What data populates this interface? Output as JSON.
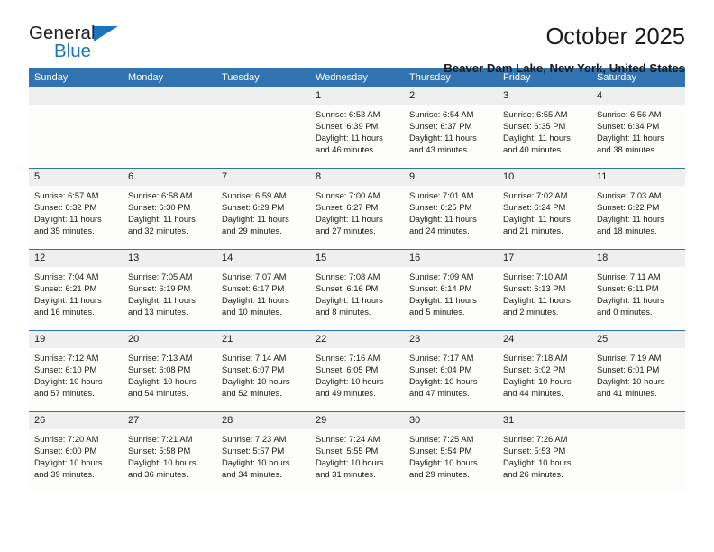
{
  "brand": {
    "name_part1": "General",
    "name_part2": "Blue",
    "triangle_color": "#1b75bb"
  },
  "header": {
    "month_title": "October 2025",
    "location": "Beaver Dam Lake, New York, United States"
  },
  "theme": {
    "header_blue": "#3173b0",
    "daynum_band": "#efefef",
    "cell_background": "#fdfdfc",
    "text": "#1a1a1a"
  },
  "weekday_headers": [
    "Sunday",
    "Monday",
    "Tuesday",
    "Wednesday",
    "Thursday",
    "Friday",
    "Saturday"
  ],
  "weeks": [
    [
      {
        "day": "",
        "sunrise": "",
        "sunset": "",
        "daylight_line1": "",
        "daylight_line2": ""
      },
      {
        "day": "",
        "sunrise": "",
        "sunset": "",
        "daylight_line1": "",
        "daylight_line2": ""
      },
      {
        "day": "",
        "sunrise": "",
        "sunset": "",
        "daylight_line1": "",
        "daylight_line2": ""
      },
      {
        "day": "1",
        "sunrise": "Sunrise: 6:53 AM",
        "sunset": "Sunset: 6:39 PM",
        "daylight_line1": "Daylight: 11 hours",
        "daylight_line2": "and 46 minutes."
      },
      {
        "day": "2",
        "sunrise": "Sunrise: 6:54 AM",
        "sunset": "Sunset: 6:37 PM",
        "daylight_line1": "Daylight: 11 hours",
        "daylight_line2": "and 43 minutes."
      },
      {
        "day": "3",
        "sunrise": "Sunrise: 6:55 AM",
        "sunset": "Sunset: 6:35 PM",
        "daylight_line1": "Daylight: 11 hours",
        "daylight_line2": "and 40 minutes."
      },
      {
        "day": "4",
        "sunrise": "Sunrise: 6:56 AM",
        "sunset": "Sunset: 6:34 PM",
        "daylight_line1": "Daylight: 11 hours",
        "daylight_line2": "and 38 minutes."
      }
    ],
    [
      {
        "day": "5",
        "sunrise": "Sunrise: 6:57 AM",
        "sunset": "Sunset: 6:32 PM",
        "daylight_line1": "Daylight: 11 hours",
        "daylight_line2": "and 35 minutes."
      },
      {
        "day": "6",
        "sunrise": "Sunrise: 6:58 AM",
        "sunset": "Sunset: 6:30 PM",
        "daylight_line1": "Daylight: 11 hours",
        "daylight_line2": "and 32 minutes."
      },
      {
        "day": "7",
        "sunrise": "Sunrise: 6:59 AM",
        "sunset": "Sunset: 6:29 PM",
        "daylight_line1": "Daylight: 11 hours",
        "daylight_line2": "and 29 minutes."
      },
      {
        "day": "8",
        "sunrise": "Sunrise: 7:00 AM",
        "sunset": "Sunset: 6:27 PM",
        "daylight_line1": "Daylight: 11 hours",
        "daylight_line2": "and 27 minutes."
      },
      {
        "day": "9",
        "sunrise": "Sunrise: 7:01 AM",
        "sunset": "Sunset: 6:25 PM",
        "daylight_line1": "Daylight: 11 hours",
        "daylight_line2": "and 24 minutes."
      },
      {
        "day": "10",
        "sunrise": "Sunrise: 7:02 AM",
        "sunset": "Sunset: 6:24 PM",
        "daylight_line1": "Daylight: 11 hours",
        "daylight_line2": "and 21 minutes."
      },
      {
        "day": "11",
        "sunrise": "Sunrise: 7:03 AM",
        "sunset": "Sunset: 6:22 PM",
        "daylight_line1": "Daylight: 11 hours",
        "daylight_line2": "and 18 minutes."
      }
    ],
    [
      {
        "day": "12",
        "sunrise": "Sunrise: 7:04 AM",
        "sunset": "Sunset: 6:21 PM",
        "daylight_line1": "Daylight: 11 hours",
        "daylight_line2": "and 16 minutes."
      },
      {
        "day": "13",
        "sunrise": "Sunrise: 7:05 AM",
        "sunset": "Sunset: 6:19 PM",
        "daylight_line1": "Daylight: 11 hours",
        "daylight_line2": "and 13 minutes."
      },
      {
        "day": "14",
        "sunrise": "Sunrise: 7:07 AM",
        "sunset": "Sunset: 6:17 PM",
        "daylight_line1": "Daylight: 11 hours",
        "daylight_line2": "and 10 minutes."
      },
      {
        "day": "15",
        "sunrise": "Sunrise: 7:08 AM",
        "sunset": "Sunset: 6:16 PM",
        "daylight_line1": "Daylight: 11 hours",
        "daylight_line2": "and 8 minutes."
      },
      {
        "day": "16",
        "sunrise": "Sunrise: 7:09 AM",
        "sunset": "Sunset: 6:14 PM",
        "daylight_line1": "Daylight: 11 hours",
        "daylight_line2": "and 5 minutes."
      },
      {
        "day": "17",
        "sunrise": "Sunrise: 7:10 AM",
        "sunset": "Sunset: 6:13 PM",
        "daylight_line1": "Daylight: 11 hours",
        "daylight_line2": "and 2 minutes."
      },
      {
        "day": "18",
        "sunrise": "Sunrise: 7:11 AM",
        "sunset": "Sunset: 6:11 PM",
        "daylight_line1": "Daylight: 11 hours",
        "daylight_line2": "and 0 minutes."
      }
    ],
    [
      {
        "day": "19",
        "sunrise": "Sunrise: 7:12 AM",
        "sunset": "Sunset: 6:10 PM",
        "daylight_line1": "Daylight: 10 hours",
        "daylight_line2": "and 57 minutes."
      },
      {
        "day": "20",
        "sunrise": "Sunrise: 7:13 AM",
        "sunset": "Sunset: 6:08 PM",
        "daylight_line1": "Daylight: 10 hours",
        "daylight_line2": "and 54 minutes."
      },
      {
        "day": "21",
        "sunrise": "Sunrise: 7:14 AM",
        "sunset": "Sunset: 6:07 PM",
        "daylight_line1": "Daylight: 10 hours",
        "daylight_line2": "and 52 minutes."
      },
      {
        "day": "22",
        "sunrise": "Sunrise: 7:16 AM",
        "sunset": "Sunset: 6:05 PM",
        "daylight_line1": "Daylight: 10 hours",
        "daylight_line2": "and 49 minutes."
      },
      {
        "day": "23",
        "sunrise": "Sunrise: 7:17 AM",
        "sunset": "Sunset: 6:04 PM",
        "daylight_line1": "Daylight: 10 hours",
        "daylight_line2": "and 47 minutes."
      },
      {
        "day": "24",
        "sunrise": "Sunrise: 7:18 AM",
        "sunset": "Sunset: 6:02 PM",
        "daylight_line1": "Daylight: 10 hours",
        "daylight_line2": "and 44 minutes."
      },
      {
        "day": "25",
        "sunrise": "Sunrise: 7:19 AM",
        "sunset": "Sunset: 6:01 PM",
        "daylight_line1": "Daylight: 10 hours",
        "daylight_line2": "and 41 minutes."
      }
    ],
    [
      {
        "day": "26",
        "sunrise": "Sunrise: 7:20 AM",
        "sunset": "Sunset: 6:00 PM",
        "daylight_line1": "Daylight: 10 hours",
        "daylight_line2": "and 39 minutes."
      },
      {
        "day": "27",
        "sunrise": "Sunrise: 7:21 AM",
        "sunset": "Sunset: 5:58 PM",
        "daylight_line1": "Daylight: 10 hours",
        "daylight_line2": "and 36 minutes."
      },
      {
        "day": "28",
        "sunrise": "Sunrise: 7:23 AM",
        "sunset": "Sunset: 5:57 PM",
        "daylight_line1": "Daylight: 10 hours",
        "daylight_line2": "and 34 minutes."
      },
      {
        "day": "29",
        "sunrise": "Sunrise: 7:24 AM",
        "sunset": "Sunset: 5:55 PM",
        "daylight_line1": "Daylight: 10 hours",
        "daylight_line2": "and 31 minutes."
      },
      {
        "day": "30",
        "sunrise": "Sunrise: 7:25 AM",
        "sunset": "Sunset: 5:54 PM",
        "daylight_line1": "Daylight: 10 hours",
        "daylight_line2": "and 29 minutes."
      },
      {
        "day": "31",
        "sunrise": "Sunrise: 7:26 AM",
        "sunset": "Sunset: 5:53 PM",
        "daylight_line1": "Daylight: 10 hours",
        "daylight_line2": "and 26 minutes."
      },
      {
        "day": "",
        "sunrise": "",
        "sunset": "",
        "daylight_line1": "",
        "daylight_line2": ""
      }
    ]
  ]
}
